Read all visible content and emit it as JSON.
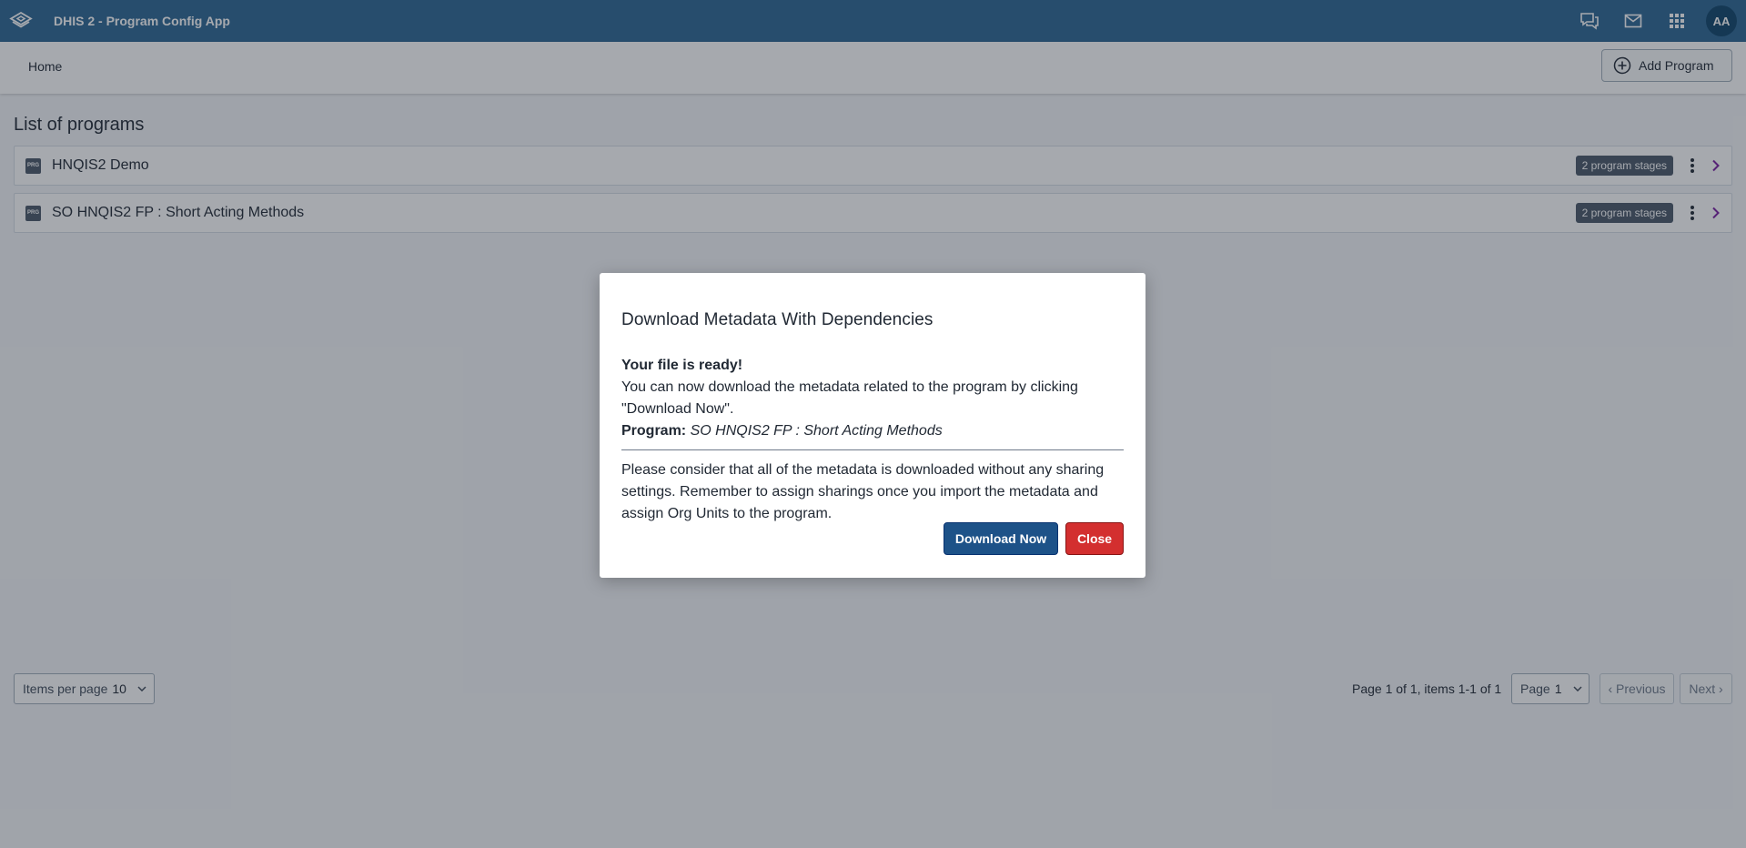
{
  "header": {
    "app_title": "DHIS 2 - Program Config App",
    "avatar_initials": "AA",
    "icons": [
      "logo-icon",
      "interpretations-icon",
      "messages-icon",
      "apps-grid-icon"
    ]
  },
  "subheader": {
    "breadcrumb": "Home",
    "add_program_label": "Add Program"
  },
  "main": {
    "list_title": "List of programs",
    "programs": [
      {
        "icon_text": "PRG",
        "name": "HNQIS2 Demo",
        "badge": "2 program stages"
      },
      {
        "icon_text": "PRG",
        "name": "SO HNQIS2 FP : Short Acting Methods",
        "badge": "2 program stages"
      }
    ]
  },
  "pagination": {
    "items_per_page_label": "Items per page",
    "items_per_page_value": "10",
    "summary": "Page 1 of 1, items 1-1 of 1",
    "page_label": "Page",
    "page_value": "1",
    "previous_label": "‹ Previous",
    "next_label": "Next ›"
  },
  "modal": {
    "title": "Download Metadata With Dependencies",
    "ready_text": "Your file is ready!",
    "instructions": "You can now download the metadata related to the program by clicking \"Download Now\".",
    "program_label": "Program:",
    "program_value": "SO HNQIS2 FP : Short Acting Methods",
    "note": "Please consider that all of the metadata is downloaded without any sharing settings. Remember to assign sharings once you import the metadata and assign Org Units to the program.",
    "download_label": "Download Now",
    "close_label": "Close"
  },
  "colors": {
    "header_bg": "#2c6693",
    "primary_button": "#1d5288",
    "destructive_button": "#d32f2f",
    "badge_bg": "#4a5768",
    "chevron": "#7b1fa2"
  }
}
